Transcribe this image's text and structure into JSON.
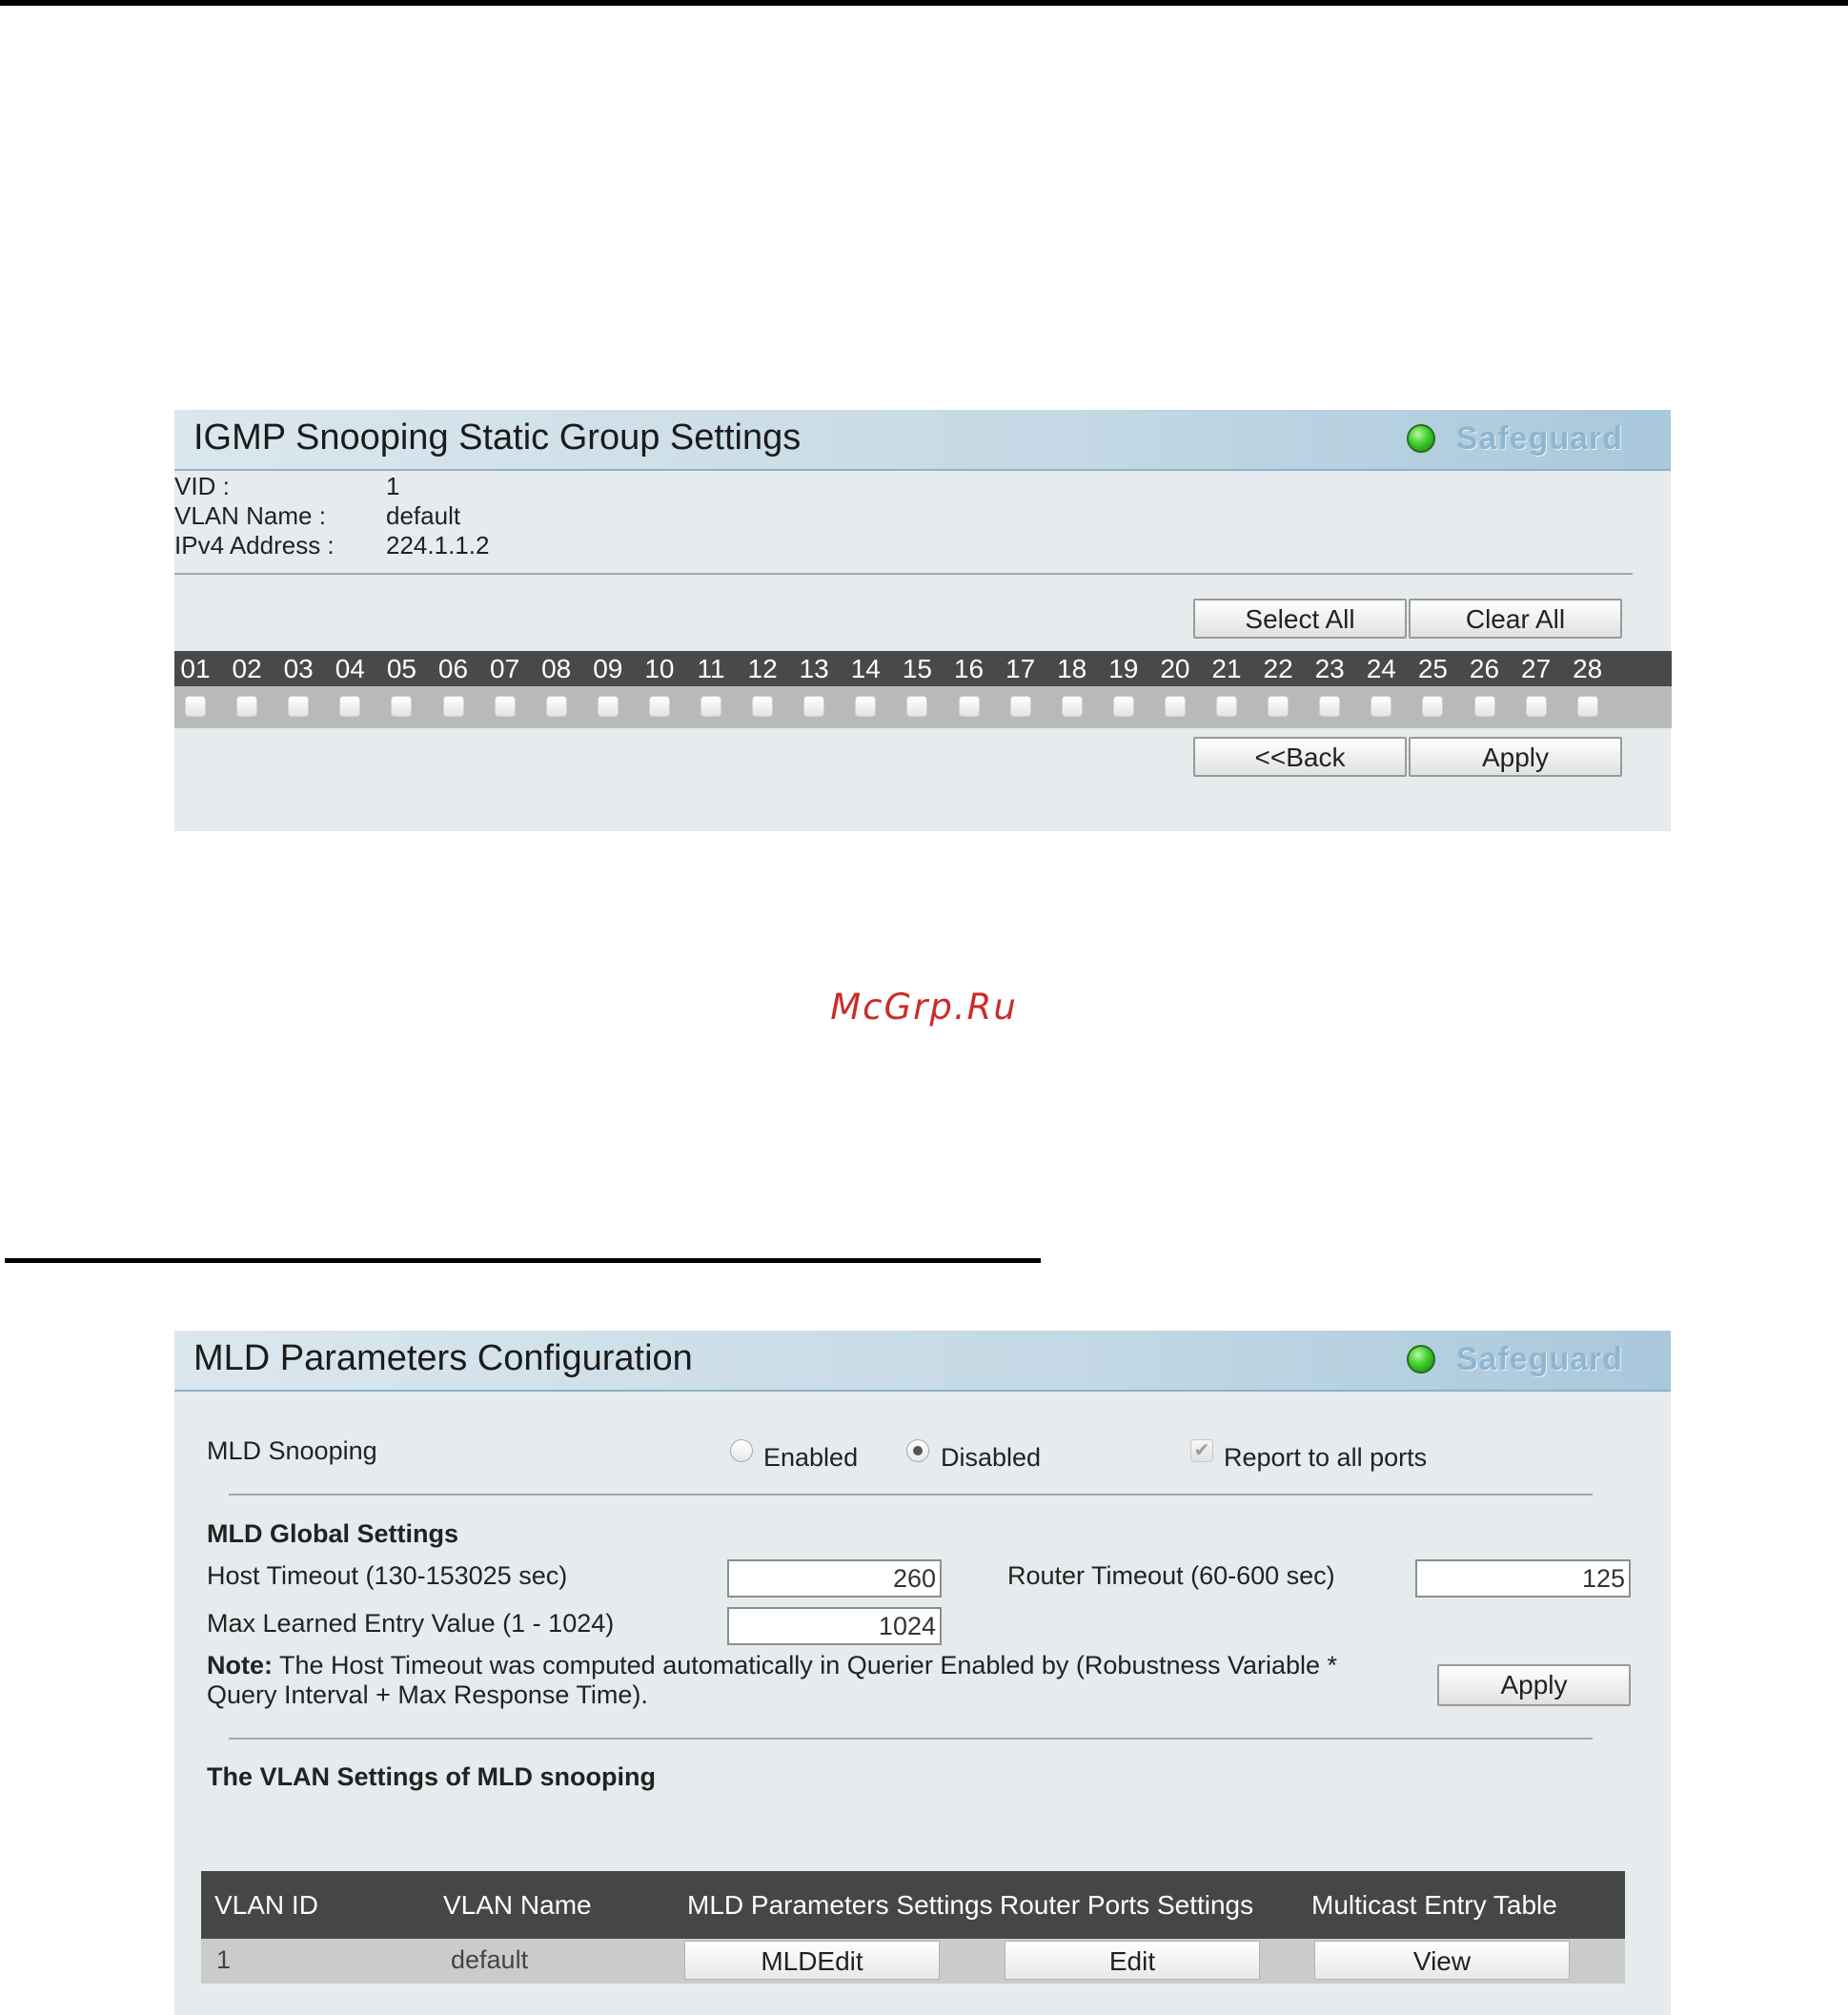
{
  "watermark": "McGrp.Ru",
  "igmp": {
    "title": "IGMP Snooping Static Group Settings",
    "safeguard": "Safeguard",
    "vid_label": "VID :",
    "vid_value": "1",
    "vlan_name_label": "VLAN Name :",
    "vlan_name_value": "default",
    "ipv4_label": "IPv4 Address :",
    "ipv4_value": "224.1.1.2",
    "select_all": "Select All",
    "clear_all": "Clear All",
    "back": "<<Back",
    "apply": "Apply",
    "ports": [
      "01",
      "02",
      "03",
      "04",
      "05",
      "06",
      "07",
      "08",
      "09",
      "10",
      "11",
      "12",
      "13",
      "14",
      "15",
      "16",
      "17",
      "18",
      "19",
      "20",
      "21",
      "22",
      "23",
      "24",
      "25",
      "26",
      "27",
      "28"
    ],
    "ports_checked": []
  },
  "mld": {
    "title": "MLD Parameters Configuration",
    "safeguard": "Safeguard",
    "snooping_label": "MLD Snooping",
    "enabled_label": "Enabled",
    "disabled_label": "Disabled",
    "snooping_state": "Disabled",
    "report_label": "Report to all ports",
    "report_checked": true,
    "global_heading": "MLD Global Settings",
    "host_timeout_label": "Host Timeout (130-153025 sec)",
    "host_timeout_value": "260",
    "router_timeout_label": "Router Timeout (60-600 sec)",
    "router_timeout_value": "125",
    "max_entry_label": "Max Learned Entry Value (1 - 1024)",
    "max_entry_value": "1024",
    "note_bold": "Note:",
    "note_line1": " The Host Timeout was computed automatically in Querier Enabled by (Robustness Variable *",
    "note_line2": "Query Interval + Max Response Time).",
    "apply": "Apply",
    "vlan_heading": "The VLAN Settings of MLD snooping",
    "table": {
      "columns": [
        "VLAN ID",
        "VLAN Name",
        "MLD Parameters Settings",
        "Router Ports Settings",
        "Multicast Entry Table"
      ],
      "rows": [
        {
          "vlan_id": "1",
          "vlan_name": "default",
          "mld_button": "MLDEdit",
          "router_button": "Edit",
          "multicast_button": "View"
        }
      ]
    }
  },
  "colors": {
    "header_gradient_end": "#a9c8db",
    "panel_bg": "#e6ebee",
    "table_header": "#464646",
    "watermark": "#cc2b2b",
    "led": "#3fcf2a"
  }
}
